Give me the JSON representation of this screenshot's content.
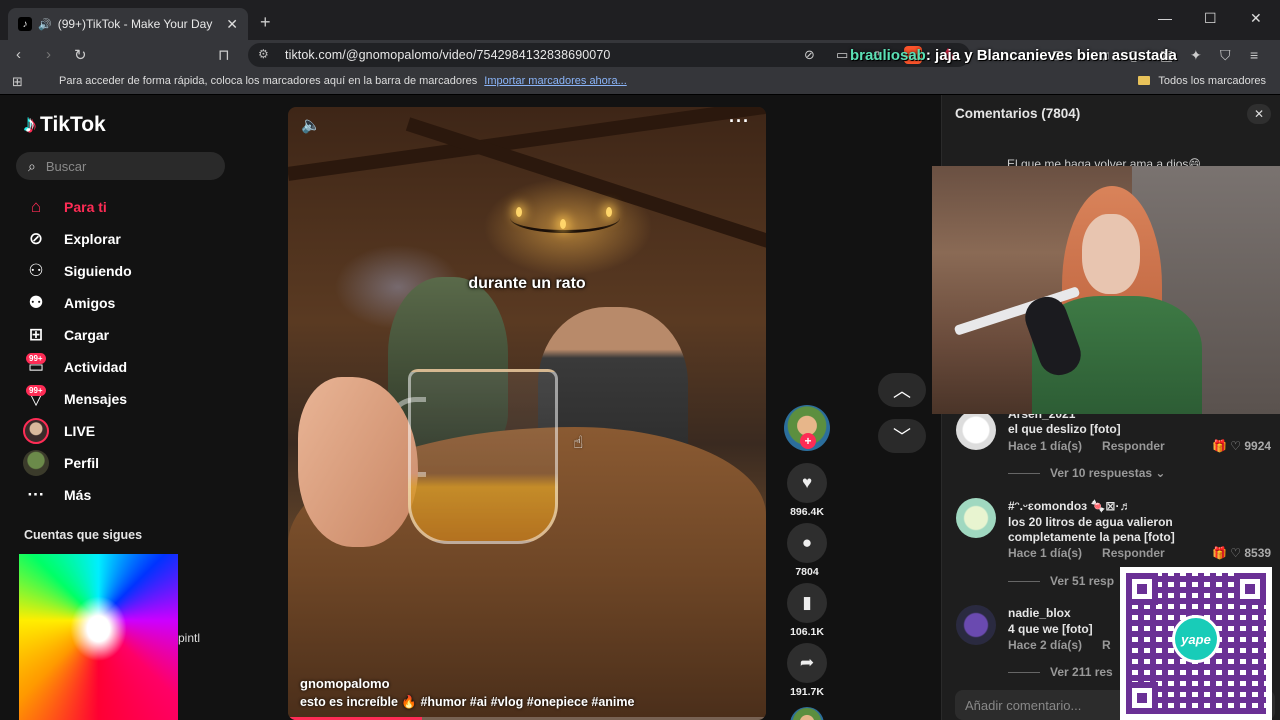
{
  "browser": {
    "tab_title": "(99+)TikTok - Make Your Day",
    "url": "tiktok.com/@gnomopalomo/video/7542984132838690070",
    "bookmark_hint": "Para acceder de forma rápida, coloca los marcadores aquí en la barra de marcadores",
    "bookmark_import": "Importar marcadores ahora...",
    "all_bookmarks": "Todos los marcadores"
  },
  "sidebar": {
    "logo": "TikTok",
    "search_placeholder": "Buscar",
    "items": [
      {
        "label": "Para ti",
        "icon": "home-icon",
        "active": true
      },
      {
        "label": "Explorar",
        "icon": "compass-icon"
      },
      {
        "label": "Siguiendo",
        "icon": "user-follow-icon"
      },
      {
        "label": "Amigos",
        "icon": "friends-icon"
      },
      {
        "label": "Cargar",
        "icon": "upload-icon"
      },
      {
        "label": "Actividad",
        "icon": "activity-icon",
        "badge": "99+"
      },
      {
        "label": "Mensajes",
        "icon": "messages-icon",
        "badge": "99+"
      },
      {
        "label": "LIVE",
        "icon": "live-avatar"
      },
      {
        "label": "Perfil",
        "icon": "profile-avatar"
      },
      {
        "label": "Más",
        "icon": "more-icon"
      }
    ],
    "following_title": "Cuentas que sigues",
    "following_fragment": "pintl"
  },
  "video": {
    "overlay_text": "durante un rato",
    "author": "gnomopalomo",
    "description": "esto es increíble 🔥 #humor #ai #vlog #onepiece #anime",
    "progress": 0.28
  },
  "actions": {
    "likes": "896.4K",
    "comments": "7804",
    "saves": "106.1K",
    "shares": "191.7K"
  },
  "comments_panel": {
    "title": "Comentarios (7804)",
    "partial_top_comment": "El que me haga volver ama a dios😄",
    "comments": [
      {
        "user": "Arsen_2021",
        "text": "el que deslizo [foto]",
        "time": "Hace 1 día(s)",
        "reply": "Responder",
        "likes": "9924",
        "more": "Ver 10 respuestas"
      },
      {
        "user": "#ᵔ.ᵕɛomondoɜ 🍬⊠·♬",
        "text": "los 20 litros de agua valieron completamente la pena [foto]",
        "time": "Hace 1 día(s)",
        "reply": "Responder",
        "likes": "8539",
        "more": "Ver 51 resp"
      },
      {
        "user": "nadie_blox",
        "text": "4 que we [foto]",
        "time": "Hace 2 día(s)",
        "reply": "R",
        "likes": "",
        "more": "Ver 211 res"
      }
    ],
    "add_placeholder": "Añadir comentario..."
  },
  "stream": {
    "chat_user": "brauliosab",
    "chat_text": ": jaja y Blancanieves bien asustada",
    "qr_brand": "yape"
  }
}
